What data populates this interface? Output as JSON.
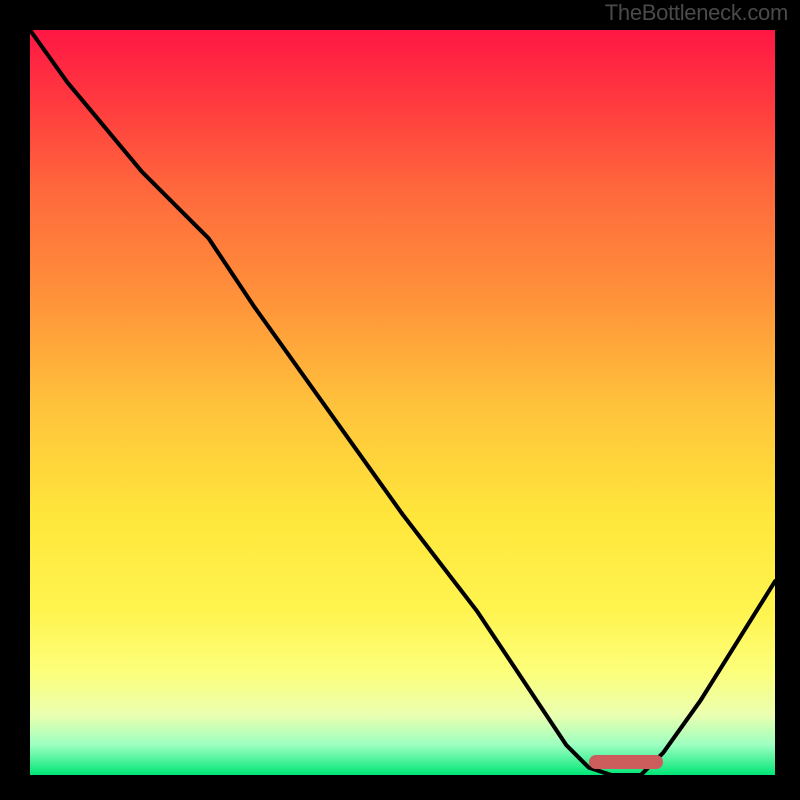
{
  "watermark": "TheBottleneck.com",
  "chart_data": {
    "type": "line",
    "title": "",
    "xlabel": "",
    "ylabel": "",
    "xlim": [
      0,
      100
    ],
    "ylim": [
      0,
      100
    ],
    "gradient_stops": [
      {
        "pct": 0,
        "color": "#ff1744"
      },
      {
        "pct": 10,
        "color": "#ff3b3f"
      },
      {
        "pct": 22,
        "color": "#ff6a3c"
      },
      {
        "pct": 35,
        "color": "#ff8f3a"
      },
      {
        "pct": 50,
        "color": "#ffc13b"
      },
      {
        "pct": 65,
        "color": "#ffe63b"
      },
      {
        "pct": 78,
        "color": "#fff44f"
      },
      {
        "pct": 86,
        "color": "#fdff7a"
      },
      {
        "pct": 92,
        "color": "#eaffb0"
      },
      {
        "pct": 96,
        "color": "#9bffc0"
      },
      {
        "pct": 100,
        "color": "#00e676"
      }
    ],
    "series": [
      {
        "name": "bottleneck-curve",
        "x": [
          0,
          5,
          10,
          15,
          20,
          22,
          24,
          30,
          40,
          50,
          60,
          68,
          72,
          75,
          78,
          82,
          85,
          90,
          95,
          100
        ],
        "y": [
          100,
          93,
          87,
          81,
          76,
          74,
          72,
          63,
          49,
          35,
          22,
          10,
          4,
          1,
          0,
          0,
          3,
          10,
          18,
          26
        ]
      }
    ],
    "marker": {
      "x_start": 75,
      "x_end": 85,
      "y": 0,
      "color": "#cd5c5c"
    }
  }
}
